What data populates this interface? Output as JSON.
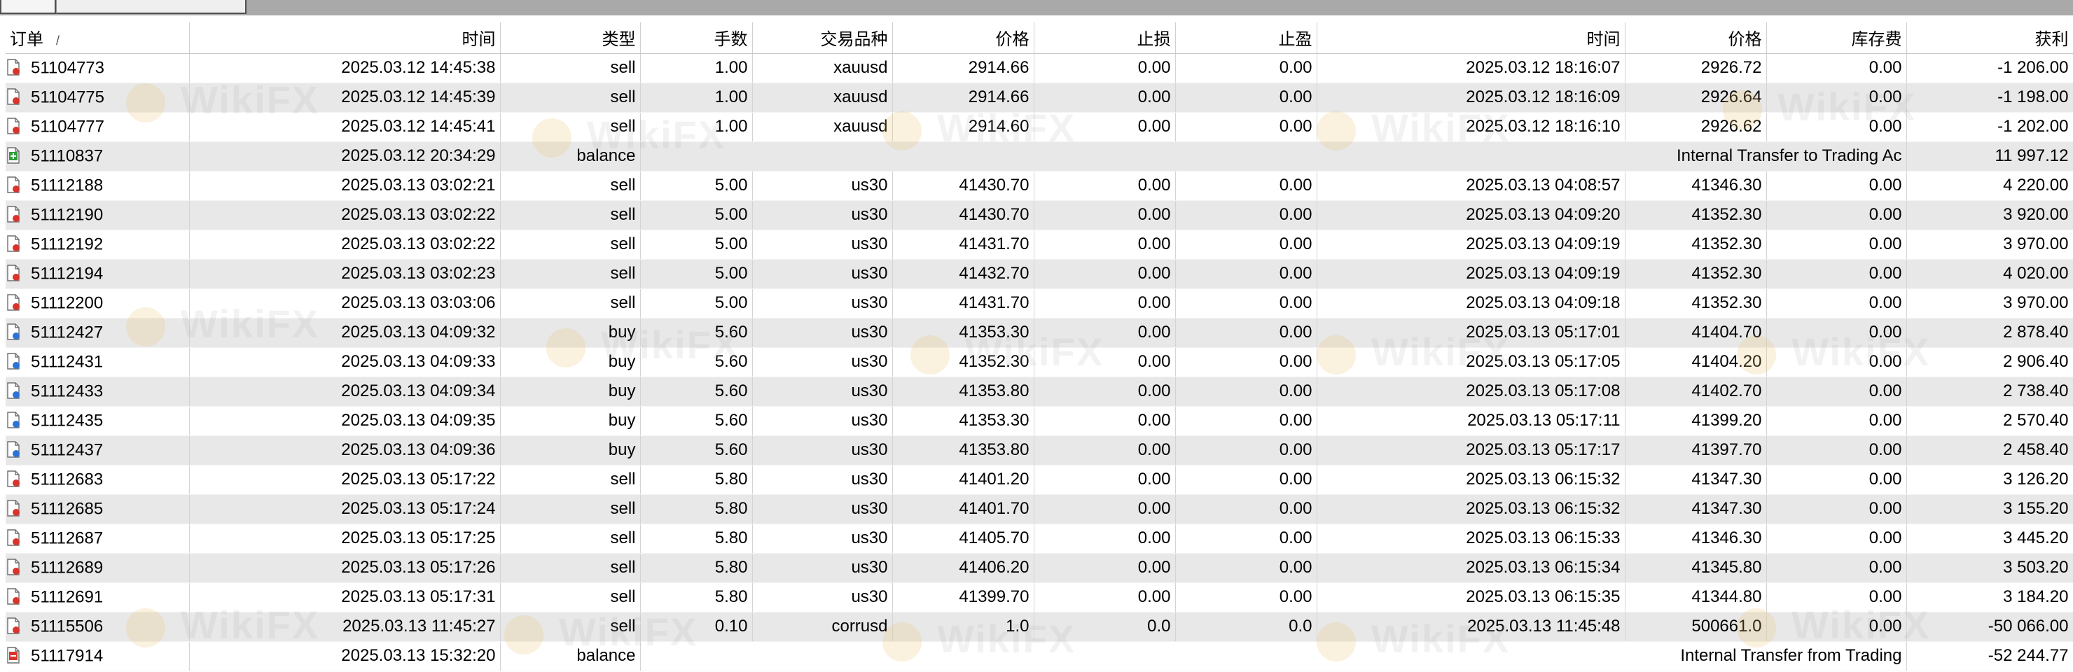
{
  "columns": [
    {
      "key": "order",
      "label": "订单",
      "sort": "/"
    },
    {
      "key": "open_time",
      "label": "时间"
    },
    {
      "key": "type",
      "label": "类型"
    },
    {
      "key": "lots",
      "label": "手数"
    },
    {
      "key": "symbol",
      "label": "交易品种"
    },
    {
      "key": "open_price",
      "label": "价格"
    },
    {
      "key": "sl",
      "label": "止损"
    },
    {
      "key": "tp",
      "label": "止盈"
    },
    {
      "key": "close_time",
      "label": "时间"
    },
    {
      "key": "close_price",
      "label": "价格"
    },
    {
      "key": "swap",
      "label": "库存费"
    },
    {
      "key": "profit",
      "label": "获利"
    }
  ],
  "rows": [
    {
      "icon": "trade-sell-icon",
      "order": "51104773",
      "open_time": "2025.03.12 14:45:38",
      "type": "sell",
      "lots": "1.00",
      "symbol": "xauusd",
      "open_price": "2914.66",
      "sl": "0.00",
      "tp": "0.00",
      "close_time": "2025.03.12 18:16:07",
      "close_price": "2926.72",
      "swap": "0.00",
      "profit": "-1 206.00"
    },
    {
      "icon": "trade-sell-icon",
      "order": "51104775",
      "open_time": "2025.03.12 14:45:39",
      "type": "sell",
      "lots": "1.00",
      "symbol": "xauusd",
      "open_price": "2914.66",
      "sl": "0.00",
      "tp": "0.00",
      "close_time": "2025.03.12 18:16:09",
      "close_price": "2926.64",
      "swap": "0.00",
      "profit": "-1 198.00"
    },
    {
      "icon": "trade-sell-icon",
      "order": "51104777",
      "open_time": "2025.03.12 14:45:41",
      "type": "sell",
      "lots": "1.00",
      "symbol": "xauusd",
      "open_price": "2914.60",
      "sl": "0.00",
      "tp": "0.00",
      "close_time": "2025.03.12 18:16:10",
      "close_price": "2926.62",
      "swap": "0.00",
      "profit": "-1 202.00"
    },
    {
      "icon": "balance-in-icon",
      "order": "51110837",
      "open_time": "2025.03.12 20:34:29",
      "type": "balance",
      "comment": "Internal Transfer to Trading Ac",
      "profit": "11 997.12"
    },
    {
      "icon": "trade-sell-icon",
      "order": "51112188",
      "open_time": "2025.03.13 03:02:21",
      "type": "sell",
      "lots": "5.00",
      "symbol": "us30",
      "open_price": "41430.70",
      "sl": "0.00",
      "tp": "0.00",
      "close_time": "2025.03.13 04:08:57",
      "close_price": "41346.30",
      "swap": "0.00",
      "profit": "4 220.00"
    },
    {
      "icon": "trade-sell-icon",
      "order": "51112190",
      "open_time": "2025.03.13 03:02:22",
      "type": "sell",
      "lots": "5.00",
      "symbol": "us30",
      "open_price": "41430.70",
      "sl": "0.00",
      "tp": "0.00",
      "close_time": "2025.03.13 04:09:20",
      "close_price": "41352.30",
      "swap": "0.00",
      "profit": "3 920.00"
    },
    {
      "icon": "trade-sell-icon",
      "order": "51112192",
      "open_time": "2025.03.13 03:02:22",
      "type": "sell",
      "lots": "5.00",
      "symbol": "us30",
      "open_price": "41431.70",
      "sl": "0.00",
      "tp": "0.00",
      "close_time": "2025.03.13 04:09:19",
      "close_price": "41352.30",
      "swap": "0.00",
      "profit": "3 970.00"
    },
    {
      "icon": "trade-sell-icon",
      "order": "51112194",
      "open_time": "2025.03.13 03:02:23",
      "type": "sell",
      "lots": "5.00",
      "symbol": "us30",
      "open_price": "41432.70",
      "sl": "0.00",
      "tp": "0.00",
      "close_time": "2025.03.13 04:09:19",
      "close_price": "41352.30",
      "swap": "0.00",
      "profit": "4 020.00"
    },
    {
      "icon": "trade-sell-icon",
      "order": "51112200",
      "open_time": "2025.03.13 03:03:06",
      "type": "sell",
      "lots": "5.00",
      "symbol": "us30",
      "open_price": "41431.70",
      "sl": "0.00",
      "tp": "0.00",
      "close_time": "2025.03.13 04:09:18",
      "close_price": "41352.30",
      "swap": "0.00",
      "profit": "3 970.00"
    },
    {
      "icon": "trade-buy-icon",
      "order": "51112427",
      "open_time": "2025.03.13 04:09:32",
      "type": "buy",
      "lots": "5.60",
      "symbol": "us30",
      "open_price": "41353.30",
      "sl": "0.00",
      "tp": "0.00",
      "close_time": "2025.03.13 05:17:01",
      "close_price": "41404.70",
      "swap": "0.00",
      "profit": "2 878.40"
    },
    {
      "icon": "trade-buy-icon",
      "order": "51112431",
      "open_time": "2025.03.13 04:09:33",
      "type": "buy",
      "lots": "5.60",
      "symbol": "us30",
      "open_price": "41352.30",
      "sl": "0.00",
      "tp": "0.00",
      "close_time": "2025.03.13 05:17:05",
      "close_price": "41404.20",
      "swap": "0.00",
      "profit": "2 906.40"
    },
    {
      "icon": "trade-buy-icon",
      "order": "51112433",
      "open_time": "2025.03.13 04:09:34",
      "type": "buy",
      "lots": "5.60",
      "symbol": "us30",
      "open_price": "41353.80",
      "sl": "0.00",
      "tp": "0.00",
      "close_time": "2025.03.13 05:17:08",
      "close_price": "41402.70",
      "swap": "0.00",
      "profit": "2 738.40"
    },
    {
      "icon": "trade-buy-icon",
      "order": "51112435",
      "open_time": "2025.03.13 04:09:35",
      "type": "buy",
      "lots": "5.60",
      "symbol": "us30",
      "open_price": "41353.30",
      "sl": "0.00",
      "tp": "0.00",
      "close_time": "2025.03.13 05:17:11",
      "close_price": "41399.20",
      "swap": "0.00",
      "profit": "2 570.40"
    },
    {
      "icon": "trade-buy-icon",
      "order": "51112437",
      "open_time": "2025.03.13 04:09:36",
      "type": "buy",
      "lots": "5.60",
      "symbol": "us30",
      "open_price": "41353.80",
      "sl": "0.00",
      "tp": "0.00",
      "close_time": "2025.03.13 05:17:17",
      "close_price": "41397.70",
      "swap": "0.00",
      "profit": "2 458.40"
    },
    {
      "icon": "trade-sell-icon",
      "order": "51112683",
      "open_time": "2025.03.13 05:17:22",
      "type": "sell",
      "lots": "5.80",
      "symbol": "us30",
      "open_price": "41401.20",
      "sl": "0.00",
      "tp": "0.00",
      "close_time": "2025.03.13 06:15:32",
      "close_price": "41347.30",
      "swap": "0.00",
      "profit": "3 126.20"
    },
    {
      "icon": "trade-sell-icon",
      "order": "51112685",
      "open_time": "2025.03.13 05:17:24",
      "type": "sell",
      "lots": "5.80",
      "symbol": "us30",
      "open_price": "41401.70",
      "sl": "0.00",
      "tp": "0.00",
      "close_time": "2025.03.13 06:15:32",
      "close_price": "41347.30",
      "swap": "0.00",
      "profit": "3 155.20"
    },
    {
      "icon": "trade-sell-icon",
      "order": "51112687",
      "open_time": "2025.03.13 05:17:25",
      "type": "sell",
      "lots": "5.80",
      "symbol": "us30",
      "open_price": "41405.70",
      "sl": "0.00",
      "tp": "0.00",
      "close_time": "2025.03.13 06:15:33",
      "close_price": "41346.30",
      "swap": "0.00",
      "profit": "3 445.20"
    },
    {
      "icon": "trade-sell-icon",
      "order": "51112689",
      "open_time": "2025.03.13 05:17:26",
      "type": "sell",
      "lots": "5.80",
      "symbol": "us30",
      "open_price": "41406.20",
      "sl": "0.00",
      "tp": "0.00",
      "close_time": "2025.03.13 06:15:34",
      "close_price": "41345.80",
      "swap": "0.00",
      "profit": "3 503.20"
    },
    {
      "icon": "trade-sell-icon",
      "order": "51112691",
      "open_time": "2025.03.13 05:17:31",
      "type": "sell",
      "lots": "5.80",
      "symbol": "us30",
      "open_price": "41399.70",
      "sl": "0.00",
      "tp": "0.00",
      "close_time": "2025.03.13 06:15:35",
      "close_price": "41344.80",
      "swap": "0.00",
      "profit": "3 184.20"
    },
    {
      "icon": "trade-sell-icon",
      "order": "51115506",
      "open_time": "2025.03.13 11:45:27",
      "type": "sell",
      "lots": "0.10",
      "symbol": "corrusd",
      "open_price": "1.0",
      "sl": "0.0",
      "tp": "0.0",
      "close_time": "2025.03.13 11:45:48",
      "close_price": "500661.0",
      "swap": "0.00",
      "profit": "-50 066.00"
    },
    {
      "icon": "balance-out-icon",
      "order": "51117914",
      "open_time": "2025.03.13 15:32:20",
      "type": "balance",
      "comment": "Internal Transfer from Trading",
      "profit": "-52 244.77"
    }
  ],
  "watermark": "WikiFX",
  "colors": {
    "sell": "#d9342b",
    "buy": "#2c72d6",
    "balance_in": "#2e9e3a",
    "balance_out": "#d9342b",
    "row_alt": "#e8e8e8"
  }
}
